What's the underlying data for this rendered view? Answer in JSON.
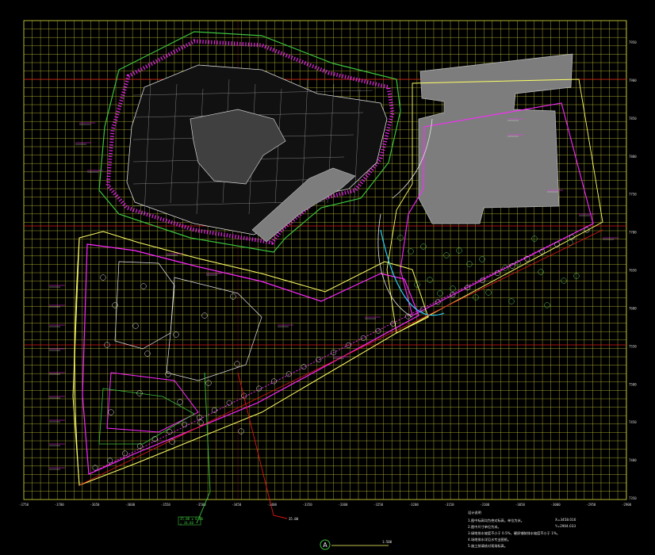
{
  "drawing": {
    "title_symbol": "A",
    "title_scale": "1:500",
    "colors": {
      "background": "#000000",
      "grid": "#cfcf3a",
      "red_axis": "#e01515",
      "site_boundary": "#ffff66",
      "green_boundary": "#3cc43c",
      "magenta": "#ff28ff",
      "building_fill": "#7d7d7d",
      "white": "#e6e6e6",
      "cyan": "#2ad0ff"
    }
  },
  "x_axis_labels": [
    "-3750",
    "-3700",
    "-3650",
    "-3600",
    "-3550",
    "-3500",
    "-3450",
    "-3400",
    "-3350",
    "-3300",
    "-3250",
    "-3200",
    "-3150",
    "-3100",
    "-3050",
    "-3000",
    "-2950",
    "-2900"
  ],
  "y_axis_labels": [
    "7950",
    "7900",
    "7850",
    "7800",
    "7750",
    "7700",
    "7650",
    "7600",
    "7550",
    "7500",
    "7450",
    "7400",
    "7350"
  ],
  "coord_note": {
    "line1": "X=3458.016",
    "line2": "Y=2904.033"
  },
  "leader_labels": {
    "green_tag": "35.00 ± 0.00",
    "green_tag2": "△ 34.60",
    "red_tag": "35.00"
  },
  "notes": {
    "heading": "设计说明",
    "items": [
      "1.图中标高均为绝对标高，单位为米。",
      "2.图中尺寸单位为米。",
      "3.绿地排水坡度不小于 0.5%，硬质铺装排水坡度不小于 1%。",
      "4.场地排水详见水专业图纸。",
      "5.施工前请核对现场标高。"
    ]
  }
}
